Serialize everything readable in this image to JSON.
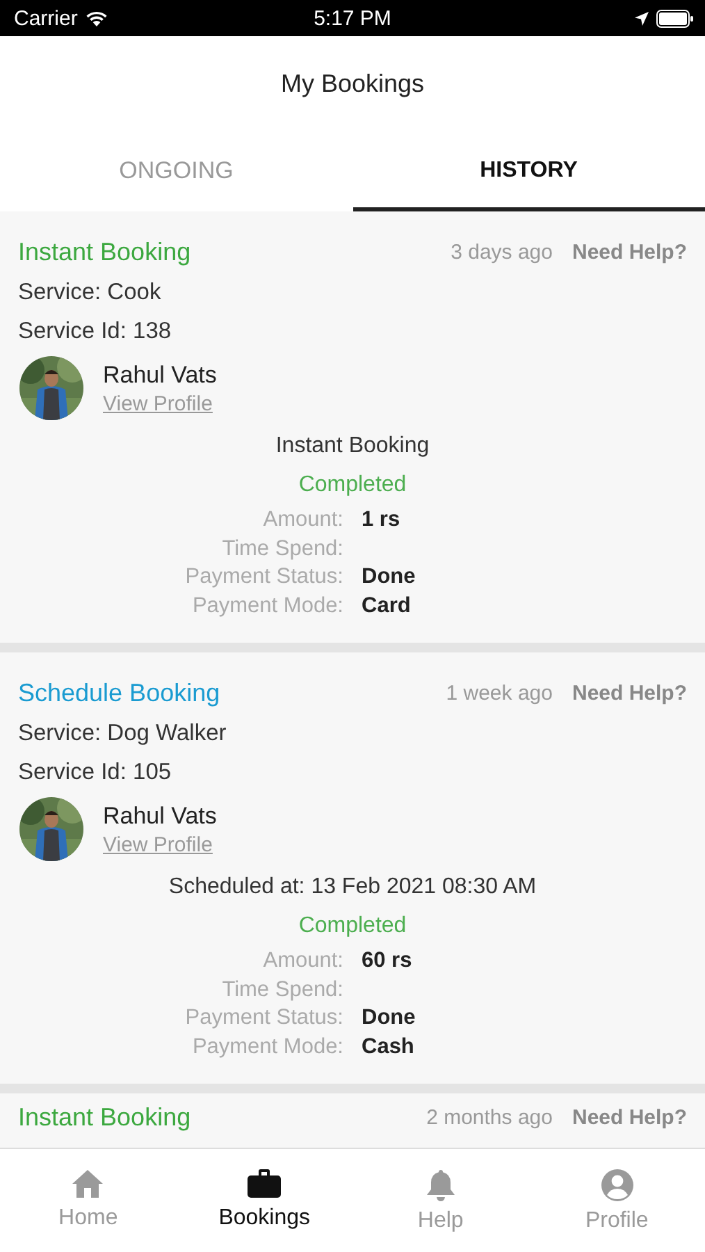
{
  "status_bar": {
    "carrier": "Carrier",
    "time": "5:17 PM"
  },
  "header": {
    "title": "My Bookings"
  },
  "tabs": [
    {
      "label": "ONGOING",
      "selected": false
    },
    {
      "label": "HISTORY",
      "selected": true
    }
  ],
  "bookings": [
    {
      "kind": "instant",
      "type": "Instant Booking",
      "ago": "3 days ago",
      "help": "Need Help?",
      "service": "Service: Cook",
      "service_id": "Service Id: 138",
      "provider": "Rahul Vats",
      "profile_link": "View Profile",
      "detail": "Instant Booking",
      "status": "Completed",
      "fields": [
        {
          "label": "Amount:",
          "value": "1 rs"
        },
        {
          "label": "Time Spend:"
        },
        {
          "label": "Payment Status:",
          "value": "Done"
        },
        {
          "label": "Payment Mode:",
          "value": "Card"
        }
      ]
    },
    {
      "kind": "schedule",
      "type": "Schedule Booking",
      "ago": "1 week ago",
      "help": "Need Help?",
      "service": "Service: Dog Walker",
      "service_id": "Service Id: 105",
      "provider": "Rahul Vats",
      "profile_link": "View Profile",
      "detail": "Scheduled at: 13 Feb 2021 08:30 AM",
      "status": "Completed",
      "fields": [
        {
          "label": "Amount:",
          "value": "60 rs"
        },
        {
          "label": "Time Spend:"
        },
        {
          "label": "Payment Status:",
          "value": "Done"
        },
        {
          "label": "Payment Mode:",
          "value": "Cash"
        }
      ]
    },
    {
      "kind": "instant",
      "type": "Instant Booking",
      "ago": "2 months ago",
      "help": "Need Help?"
    }
  ],
  "nav": [
    {
      "kind": "home",
      "label": "Home",
      "selected": false
    },
    {
      "kind": "briefcase",
      "label": "Bookings",
      "selected": true
    },
    {
      "kind": "bell",
      "label": "Help",
      "selected": false
    },
    {
      "kind": "person",
      "label": "Profile",
      "selected": false
    }
  ]
}
